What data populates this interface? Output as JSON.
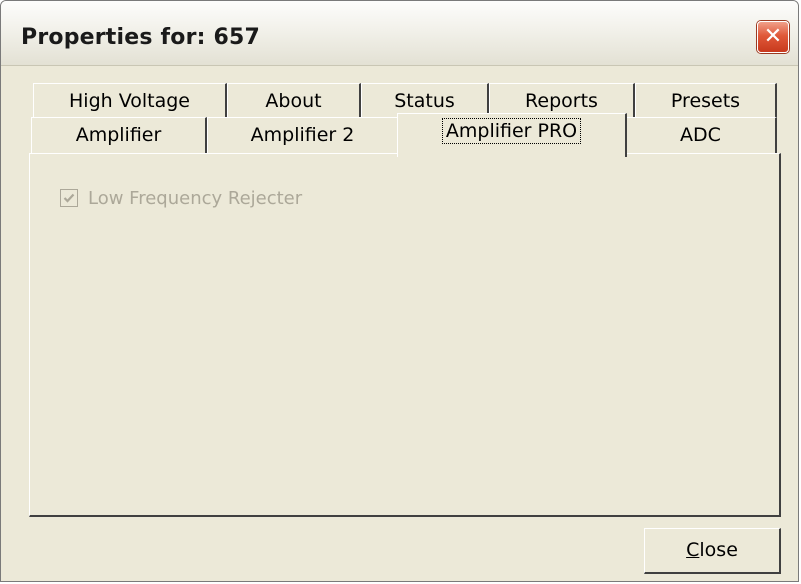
{
  "window": {
    "title": "Properties for: 657",
    "close_glyph": "✕"
  },
  "tabs": {
    "back_row": [
      {
        "label": "High Voltage"
      },
      {
        "label": "About"
      },
      {
        "label": "Status"
      },
      {
        "label": "Reports"
      },
      {
        "label": "Presets"
      }
    ],
    "front_row": [
      {
        "label": "Amplifier"
      },
      {
        "label": "Amplifier 2"
      },
      {
        "label": "Amplifier PRO",
        "selected": true
      },
      {
        "label": "ADC"
      }
    ]
  },
  "panel": {
    "checkbox": {
      "label": "Low Frequency Rejecter",
      "checked": true,
      "enabled": false
    }
  },
  "footer": {
    "close_button": {
      "mnemonic": "C",
      "rest": "lose"
    }
  },
  "icons": {
    "window_close": "close-icon",
    "checkmark": "checkmark-icon"
  },
  "colors": {
    "dialog_face": "#ece9d8",
    "disabled_text": "#aca899",
    "close_button_red": "#e0593a"
  }
}
